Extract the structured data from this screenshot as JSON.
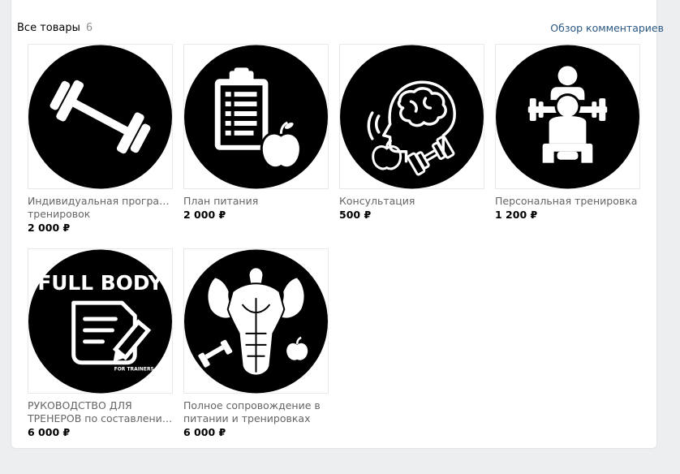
{
  "header": {
    "title": "Все товары",
    "count": "6",
    "reviews_link": "Обзор комментариев"
  },
  "products": [
    {
      "name_line1": "Индивидуальная программа",
      "name_line2": "тренировок",
      "price": "2 000 ₽",
      "icon": "barbell-icon"
    },
    {
      "name_line1": "План питания",
      "name_line2": "",
      "price": "2 000 ₽",
      "icon": "meal-plan-icon"
    },
    {
      "name_line1": "Консультация",
      "name_line2": "",
      "price": "500 ₽",
      "icon": "brain-consultation-icon"
    },
    {
      "name_line1": "Персональная тренировка",
      "name_line2": "",
      "price": "1 200 ₽",
      "icon": "personal-training-icon"
    },
    {
      "name_line1": "РУКОВОДСТВО ДЛЯ",
      "name_line2": "ТРЕНЕРОВ по составлению…",
      "price": "6 000 ₽",
      "icon": "full-body-guide-icon",
      "image_text": "FULL BODY",
      "image_subtext": "FOR TRAINERS"
    },
    {
      "name_line1": "Полное сопровождение в",
      "name_line2": "питании и тренировках",
      "price": "6 000 ₽",
      "icon": "bodybuilder-icon"
    }
  ],
  "colors": {
    "background": "#edeef0",
    "panel": "#ffffff",
    "link": "#2a5885",
    "name_text": "#656565",
    "count_text": "#939393"
  }
}
